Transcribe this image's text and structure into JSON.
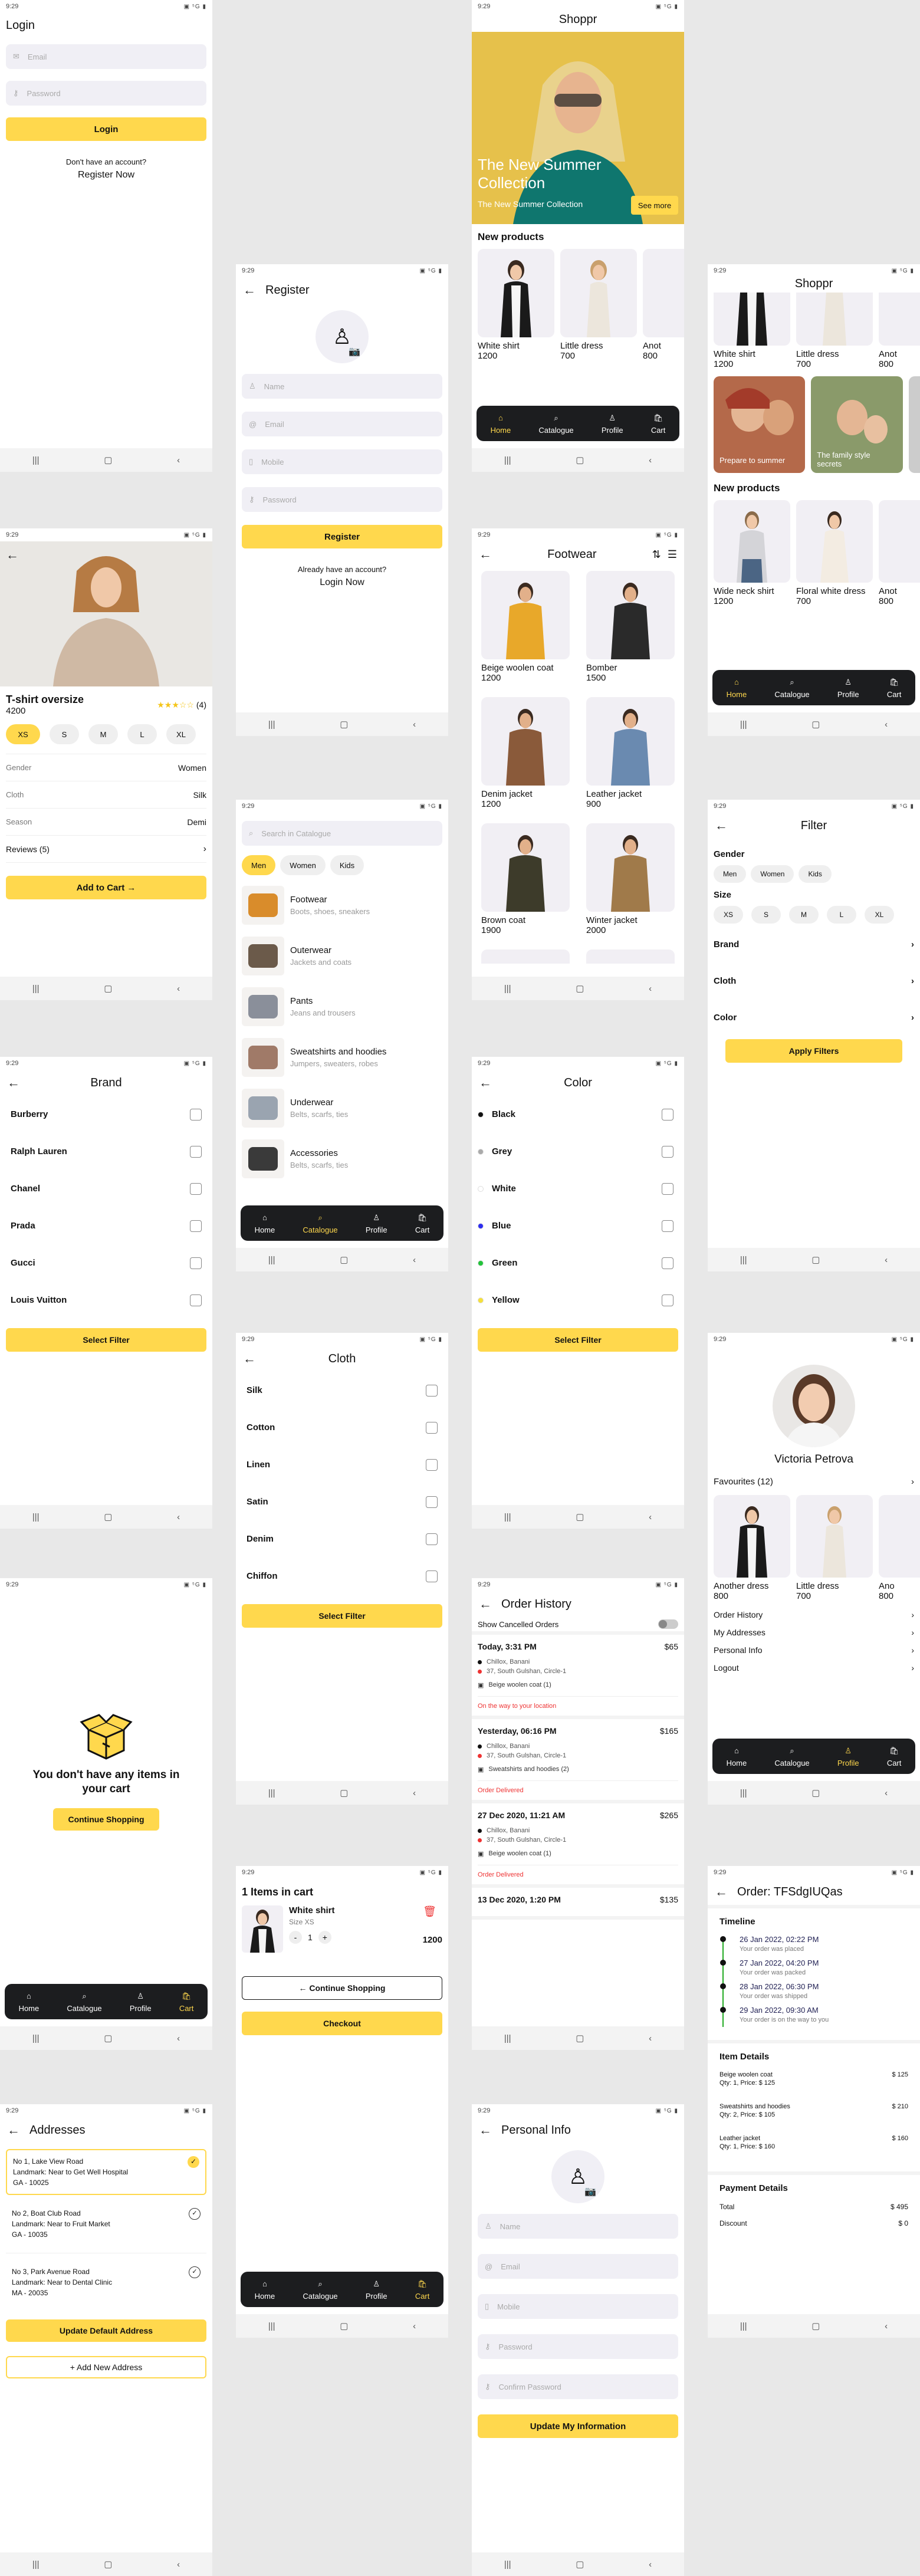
{
  "status": {
    "time": "9:29",
    "icons": "▣ ⁵G ▮"
  },
  "navbar": {
    "recent": "|||",
    "home": "▢",
    "back": "‹"
  },
  "bottom_nav": {
    "home": "Home",
    "catalogue": "Catalogue",
    "profile": "Profile",
    "cart": "Cart"
  },
  "login": {
    "title": "Login",
    "email_ph": "Email",
    "password_ph": "Password",
    "button": "Login",
    "no_account": "Don't have an account?",
    "register_link": "Register Now"
  },
  "register": {
    "title": "Register",
    "name_ph": "Name",
    "email_ph": "Email",
    "mobile_ph": "Mobile",
    "password_ph": "Password",
    "button": "Register",
    "have_account": "Already have an account?",
    "login_link": "Login Now"
  },
  "home1": {
    "brand": "Shoppr",
    "banner_title": "The New Summer Collection",
    "banner_sub": "The New Summer Collection",
    "see_more": "See more",
    "new_products": "New products",
    "products": [
      {
        "name": "White shirt",
        "price": "1200"
      },
      {
        "name": "Little dress",
        "price": "700"
      },
      {
        "name": "Anot",
        "price": "800"
      }
    ]
  },
  "home2": {
    "brand": "Shoppr",
    "top_products": [
      {
        "name": "White shirt",
        "price": "1200"
      },
      {
        "name": "Little dress",
        "price": "700"
      },
      {
        "name": "Anot",
        "price": "800"
      }
    ],
    "promo1": "Prepare to summer",
    "promo2": "The family style secrets",
    "new_products": "New products",
    "products": [
      {
        "name": "Wide neck shirt",
        "price": "1200"
      },
      {
        "name": "Floral white dress",
        "price": "700"
      },
      {
        "name": "Anot",
        "price": "800"
      }
    ]
  },
  "product": {
    "name": "T-shirt oversize",
    "price": "4200",
    "rating": "(4)",
    "sizes": [
      "XS",
      "S",
      "M",
      "L",
      "XL"
    ],
    "gender_label": "Gender",
    "gender": "Women",
    "cloth_label": "Cloth",
    "cloth": "Silk",
    "season_label": "Season",
    "season": "Demi",
    "reviews": "Reviews (5)",
    "add_to_cart": "Add to Cart"
  },
  "catalogue": {
    "search_ph": "Search in Catalogue",
    "tabs": [
      "Men",
      "Women",
      "Kids"
    ],
    "items": [
      {
        "title": "Footwear",
        "sub": "Boots, shoes, sneakers"
      },
      {
        "title": "Outerwear",
        "sub": "Jackets and coats"
      },
      {
        "title": "Pants",
        "sub": "Jeans and trousers"
      },
      {
        "title": "Sweatshirts and hoodies",
        "sub": "Jumpers, sweaters, robes"
      },
      {
        "title": "Underwear",
        "sub": "Belts, scarfs, ties"
      },
      {
        "title": "Accessories",
        "sub": "Belts, scarfs, ties"
      }
    ]
  },
  "footwear": {
    "title": "Footwear",
    "items": [
      {
        "name": "Beige woolen coat",
        "price": "1200"
      },
      {
        "name": "Bomber",
        "price": "1500"
      },
      {
        "name": "Denim jacket",
        "price": "1200"
      },
      {
        "name": "Leather jacket",
        "price": "900"
      },
      {
        "name": "Brown coat",
        "price": "1900"
      },
      {
        "name": "Winter jacket",
        "price": "2000"
      }
    ]
  },
  "filter": {
    "title": "Filter",
    "gender": "Gender",
    "genders": [
      "Men",
      "Women",
      "Kids"
    ],
    "size": "Size",
    "sizes": [
      "XS",
      "S",
      "M",
      "L",
      "XL"
    ],
    "brand": "Brand",
    "cloth": "Cloth",
    "color": "Color",
    "apply": "Apply Filters"
  },
  "brand": {
    "title": "Brand",
    "items": [
      "Burberry",
      "Ralph Lauren",
      "Chanel",
      "Prada",
      "Gucci",
      "Louis Vuitton"
    ],
    "button": "Select Filter"
  },
  "color": {
    "title": "Color",
    "items": [
      {
        "name": "Black",
        "c": "#111111"
      },
      {
        "name": "Grey",
        "c": "#aaaaaa"
      },
      {
        "name": "White",
        "c": "#ffffff"
      },
      {
        "name": "Blue",
        "c": "#2d2df0"
      },
      {
        "name": "Green",
        "c": "#22c33a"
      },
      {
        "name": "Yellow",
        "c": "#f6e03a"
      }
    ],
    "button": "Select Filter"
  },
  "cloth": {
    "title": "Cloth",
    "items": [
      "Silk",
      "Cotton",
      "Linen",
      "Satin",
      "Denim",
      "Chiffon"
    ],
    "button": "Select Filter"
  },
  "profile": {
    "name": "Victoria Petrova",
    "favourites": "Favourites (12)",
    "products": [
      {
        "name": "Another dress",
        "price": "800"
      },
      {
        "name": "Little dress",
        "price": "700"
      },
      {
        "name": "Ano",
        "price": "800"
      }
    ],
    "menu": [
      "Order History",
      "My Addresses",
      "Personal Info",
      "Logout"
    ]
  },
  "empty_cart": {
    "message": "You don't have any items in your cart",
    "button": "Continue Shopping"
  },
  "orders": {
    "title": "Order History",
    "show_cancelled": "Show Cancelled Orders",
    "list": [
      {
        "date": "Today, 3:31 PM",
        "total": "$65",
        "from": "Chillox, Banani",
        "to": "37, South Gulshan, Circle-1",
        "items": "Beige woolen coat (1)",
        "status": "On the way to your location"
      },
      {
        "date": "Yesterday, 06:16 PM",
        "total": "$165",
        "from": "Chillox, Banani",
        "to": "37, South Gulshan, Circle-1",
        "items": "Sweatshirts and hoodies (2)",
        "status": "Order Delivered"
      },
      {
        "date": "27 Dec 2020, 11:21 AM",
        "total": "$265",
        "from": "Chillox, Banani",
        "to": "37, South Gulshan, Circle-1",
        "items": "Beige woolen coat (1)",
        "status": "Order Delivered"
      },
      {
        "date": "13 Dec 2020, 1:20 PM",
        "total": "$135"
      }
    ]
  },
  "cart": {
    "title": "1 Items in cart",
    "item": "White shirt",
    "size": "Size XS",
    "qty": "1",
    "price": "1200",
    "continue": "Continue Shopping",
    "checkout": "Checkout"
  },
  "order_detail": {
    "title": "Order: TFSdgIUQas",
    "timeline": "Timeline",
    "events": [
      {
        "date": "26 Jan 2022, 02:22 PM",
        "text": "Your order was placed"
      },
      {
        "date": "27 Jan 2022, 04:20 PM",
        "text": "Your order was packed"
      },
      {
        "date": "28 Jan 2022, 06:30 PM",
        "text": "Your order was shipped"
      },
      {
        "date": "29 Jan 2022, 09:30 AM",
        "text": "Your order is on the way to you"
      }
    ],
    "item_details": "Item Details",
    "items": [
      {
        "name": "Beige woolen coat",
        "qty": "Qty: 1, Price: $ 125",
        "total": "$ 125"
      },
      {
        "name": "Sweatshirts and hoodies",
        "qty": "Qty: 2, Price: $ 105",
        "total": "$ 210"
      },
      {
        "name": "Leather jacket",
        "qty": "Qty: 1, Price: $ 160",
        "total": "$ 160"
      }
    ],
    "payment": "Payment Details",
    "total_label": "Total",
    "total": "$ 495",
    "discount_label": "Discount",
    "discount": "$ 0"
  },
  "addresses": {
    "title": "Addresses",
    "list": [
      {
        "l1": "No 1, Lake View Road",
        "l2": "Landmark: Near to Get Well Hospital",
        "l3": "GA - 10025"
      },
      {
        "l1": "No 2, Boat Club Road",
        "l2": "Landmark: Near to Fruit Market",
        "l3": "GA - 10035"
      },
      {
        "l1": "No 3, Park Avenue Road",
        "l2": "Landmark: Near to Dental Clinic",
        "l3": "MA - 20035"
      }
    ],
    "update": "Update Default Address",
    "add": "+ Add New Address"
  },
  "personal": {
    "title": "Personal Info",
    "name_ph": "Name",
    "email_ph": "Email",
    "mobile_ph": "Mobile",
    "password_ph": "Password",
    "confirm_ph": "Confirm Password",
    "button": "Update My Information"
  }
}
